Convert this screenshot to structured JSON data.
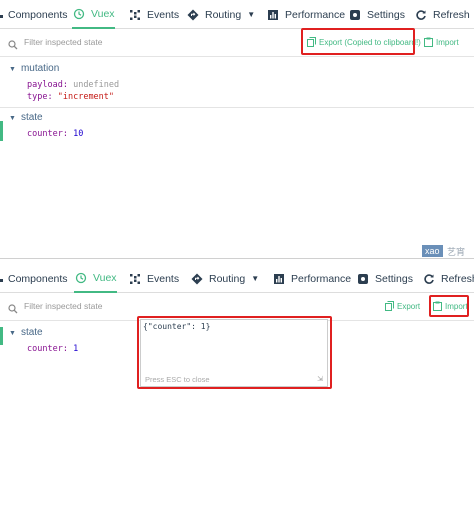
{
  "toolbar": {
    "tabs": [
      "Components",
      "Vuex",
      "Events",
      "Routing",
      "Performance",
      "Settings",
      "Refresh"
    ]
  },
  "filter": {
    "placeholder": "Filter inspected state",
    "export_label": "Export",
    "export_copied_label": "Export (Copied to clipboard!)",
    "import_label": "Import"
  },
  "top_panel": {
    "mutation": {
      "title": "mutation",
      "payload_key": "payload",
      "payload_value": "undefined",
      "type_key": "type",
      "type_value": "\"increment\""
    },
    "state": {
      "title": "state",
      "counter_key": "counter",
      "counter_value": "10"
    }
  },
  "bottom_panel": {
    "state": {
      "title": "state",
      "counter_key": "counter",
      "counter_value": "1"
    },
    "import_dialog": {
      "text": "{\"counter\": 1}",
      "hint": "Press ESC to close"
    }
  },
  "watermark": {
    "tag": "xao",
    "text": "艺宵"
  },
  "colors": {
    "accent": "#42b983",
    "highlight_box": "#e02020",
    "text": "#2c3e50"
  }
}
